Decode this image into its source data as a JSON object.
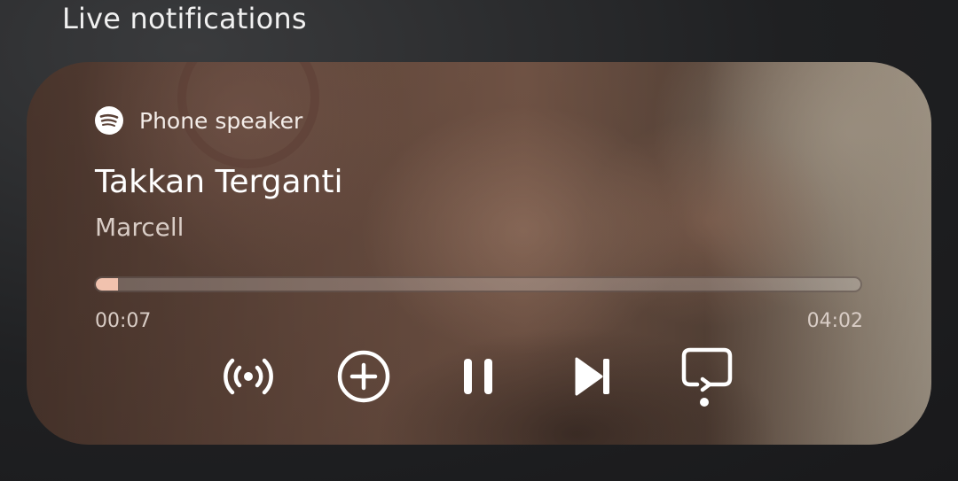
{
  "header": {
    "title": "Live notifications"
  },
  "media_player": {
    "source_icon": "spotify-icon",
    "output_device": "Phone speaker",
    "track_title": "Takkan Terganti",
    "artist": "Marcell",
    "elapsed": "00:07",
    "duration": "04:02",
    "progress_fraction": 0.029,
    "accent_color": "#f1c2ae",
    "controls": [
      {
        "name": "cast-icon"
      },
      {
        "name": "add-icon"
      },
      {
        "name": "pause-icon"
      },
      {
        "name": "skip-next-icon"
      },
      {
        "name": "output-switch-icon"
      }
    ]
  }
}
